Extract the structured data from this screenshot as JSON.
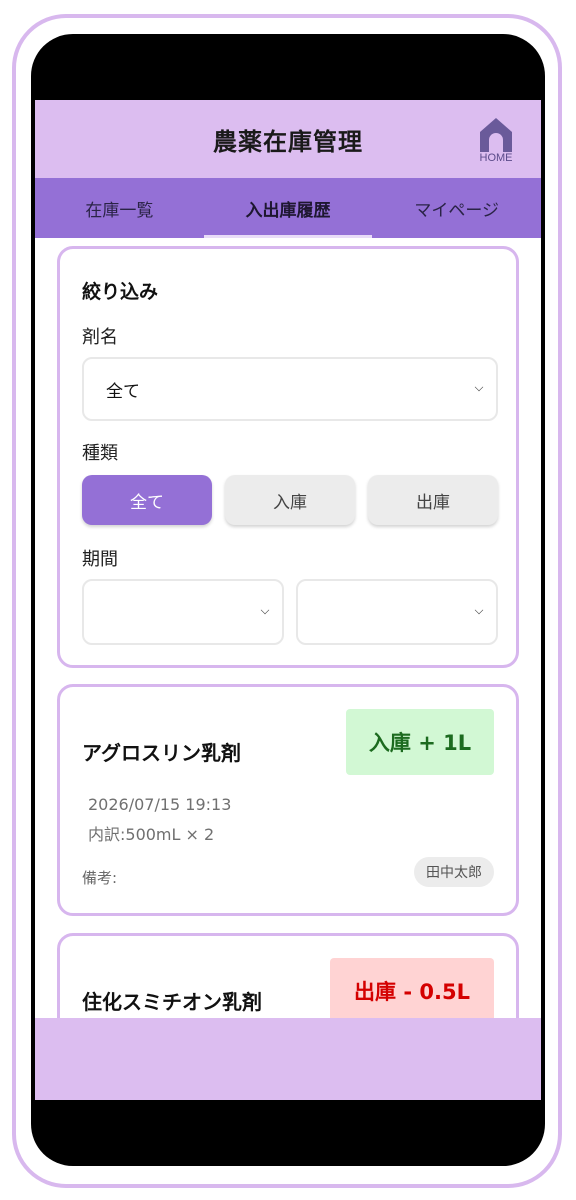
{
  "header": {
    "title": "農薬在庫管理",
    "home_label": "HOME"
  },
  "tabs": [
    {
      "label": "在庫一覧",
      "active": false
    },
    {
      "label": "入出庫履歴",
      "active": true
    },
    {
      "label": "マイページ",
      "active": false
    }
  ],
  "filter": {
    "title": "絞り込み",
    "drug_label": "剤名",
    "drug_value": "全て",
    "type_label": "種類",
    "type_options": [
      "全て",
      "入庫",
      "出庫"
    ],
    "type_selected": "全て",
    "period_label": "期間",
    "period_start": "",
    "period_end": ""
  },
  "records": [
    {
      "name": "アグロスリン乳剤",
      "badge": "入庫 + 1L",
      "kind": "in",
      "datetime": "2026/07/15 19:13",
      "detail": "内訳:500mL × 2",
      "note_label": "備考:",
      "user": "田中太郎"
    },
    {
      "name": "住化スミチオン乳剤",
      "badge": "出庫 - 0.5L",
      "kind": "out"
    }
  ],
  "colors": {
    "accent": "#9470d6",
    "header_bg": "#dcbdf0",
    "card_border": "#d7b6ee",
    "in_badge_bg": "#d2f8d4",
    "in_badge_text": "#1c6b1f",
    "out_badge_bg": "#ffd3d3",
    "out_badge_text": "#d40000"
  },
  "icons": {
    "home": "home-icon",
    "dropdown": "chevron-down-icon"
  }
}
